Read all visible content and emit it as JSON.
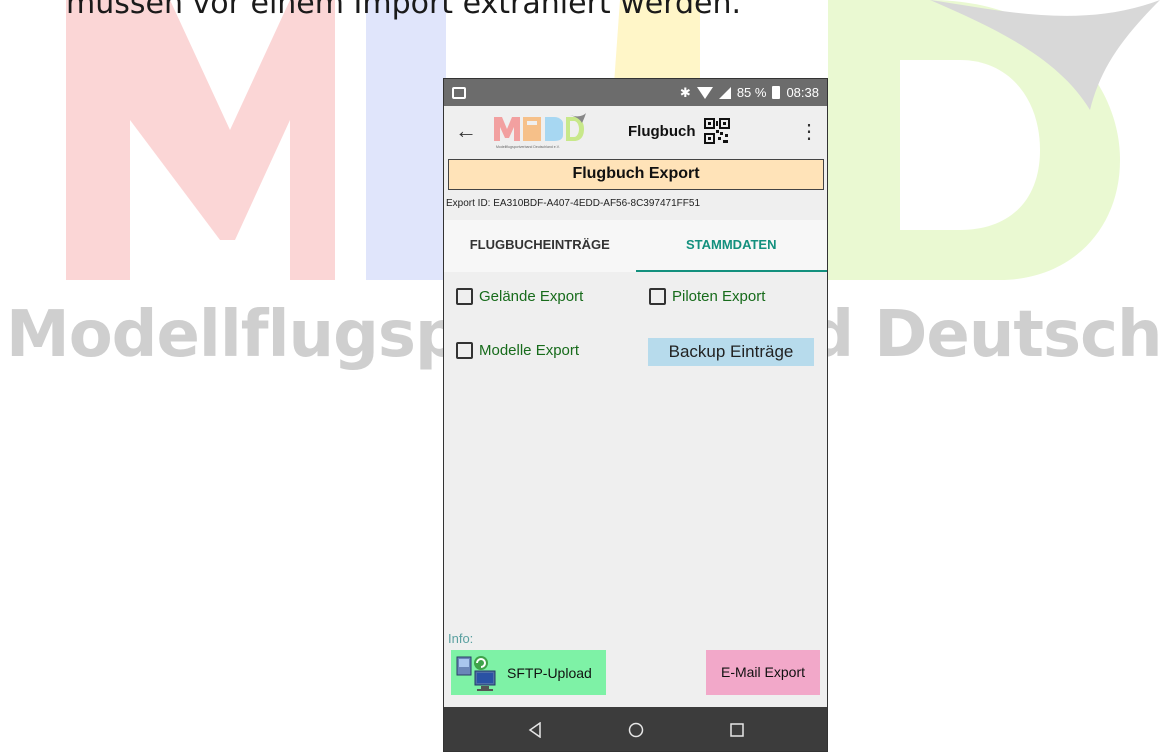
{
  "slide": {
    "caption": "müssen vor einem Import extrahiert werden.",
    "watermark_tagline": "Modellflugsportverband Deutschland e.V.",
    "watermark_brand": "MFSD"
  },
  "status_bar": {
    "battery": "85 %",
    "time": "08:38",
    "icons": [
      "image-icon",
      "bluetooth-icon",
      "wifi-icon",
      "signal-icon",
      "battery-icon"
    ]
  },
  "app_bar": {
    "logo_text": "MFSD",
    "logo_subtext": "Modellflugsportverband Deutschland e.V.",
    "title": "Flugbuch"
  },
  "header": {
    "title": "Flugbuch Export"
  },
  "export_id": "Export ID: EA310BDF-A407-4EDD-AF56-8C397471FF51",
  "tabs": [
    {
      "label": "FLUGBUCHEINTRÄGE",
      "active": false
    },
    {
      "label": "STAMMDATEN",
      "active": true
    }
  ],
  "options": {
    "gelaende": {
      "label": "Gelände Export",
      "checked": false
    },
    "piloten": {
      "label": "Piloten Export",
      "checked": false
    },
    "modelle": {
      "label": "Modelle Export",
      "checked": false
    },
    "backup_button": "Backup Einträge"
  },
  "info_label": "Info:",
  "sftp_button": "SFTP-Upload",
  "email_button": "E-Mail Export",
  "colors": {
    "header_bg": "#ffe3b8",
    "tab_accent": "#13907e",
    "sftp_bg": "#7ef2a6",
    "email_bg": "#f2a8c9",
    "backup_bg": "#b7dbec"
  }
}
